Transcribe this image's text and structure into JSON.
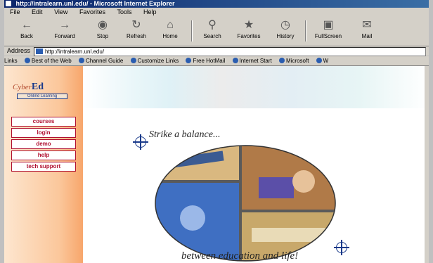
{
  "window": {
    "title": "http://intralearn.unl.edu/ - Microsoft Internet Explorer"
  },
  "menu": [
    "File",
    "Edit",
    "View",
    "Favorites",
    "Tools",
    "Help"
  ],
  "toolbar": [
    {
      "label": "Back",
      "icon": "back-arrow-icon"
    },
    {
      "label": "Forward",
      "icon": "forward-arrow-icon"
    },
    {
      "label": "Stop",
      "icon": "stop-icon"
    },
    {
      "label": "Refresh",
      "icon": "refresh-icon"
    },
    {
      "label": "Home",
      "icon": "home-icon"
    },
    {
      "label": "Search",
      "icon": "search-icon"
    },
    {
      "label": "Favorites",
      "icon": "favorites-icon"
    },
    {
      "label": "History",
      "icon": "history-icon"
    },
    {
      "label": "FullScreen",
      "icon": "fullscreen-icon"
    },
    {
      "label": "Mail",
      "icon": "mail-icon"
    }
  ],
  "address": {
    "label": "Address",
    "value": "http://intralearn.unl.edu/"
  },
  "links": {
    "label": "Links",
    "items": [
      "Best of the Web",
      "Channel Guide",
      "Customize Links",
      "Free HotMail",
      "Internet Start",
      "Microsoft",
      "W"
    ]
  },
  "page": {
    "logo": {
      "cyber": "Cyber",
      "ed": "Ed",
      "subtitle": "Online Learning"
    },
    "nav": [
      "courses",
      "login",
      "demo",
      "help",
      "tech support"
    ],
    "tagline_top": "Strike a balance...",
    "tagline_bottom": "between education and life!"
  },
  "colors": {
    "nav_border": "#b01030",
    "brand_blue": "#1a3a8a",
    "title_bar": "#0a246a"
  }
}
